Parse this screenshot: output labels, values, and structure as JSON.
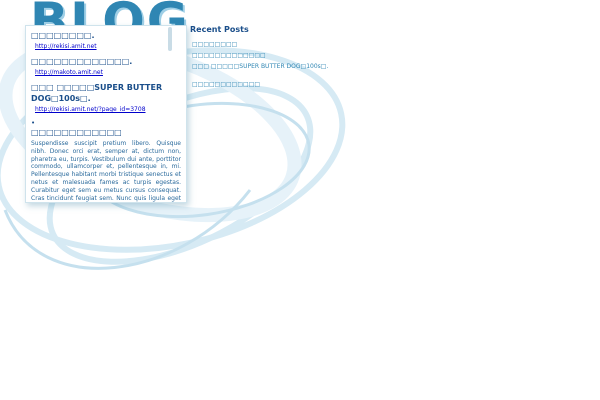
{
  "logo": {
    "text": "BLOG"
  },
  "posts": [
    {
      "title": "□□□□□□□□.",
      "link": "http://rekisi.amit.net"
    },
    {
      "title": "□□□□□□□□□□□□□.",
      "link": "http://makoto.amit.net"
    },
    {
      "title": "□□□ □□□□□SUPER BUTTER DOG□100s□.",
      "link": "http://rekisi.amit.net/?page_id=3708"
    }
  ],
  "bullet": "•",
  "article": {
    "title": "□□□□□□□□□□□□",
    "body": "Suspendisse suscipit pretium libero. Quisque nibh. Donec orci erat, semper at, dictum non, pharetra eu, turpis. Vestibulum dui ante, porttitor commodo, ullamcorper et, pellentesque in, mi. Pellentesque habitant morbi tristique senectus et netus et malesuada fames ac turpis egestas. Curabitur eget sem eu metus cursus consequat. Cras tincidunt feugiat sem. Nunc quis ligula eget libero tempus elementum. Ut lacinia. Praesent sit amet nisl nec eros porta ultrices. Sed id felis. Duis tellus. Ut vehicula mi eu diam. In"
  },
  "sidebar": {
    "heading": "Recent Posts",
    "items": [
      "□□□□□□□□",
      "□□□□□□□□□□□□□",
      "□□□ □□□□□SUPER BUTTER DOG□100s□.",
      "□□□□□□□□□□□□"
    ]
  },
  "colors": {
    "accent": "#2f86b3",
    "title": "#1a4e8a",
    "link": "#0000cc",
    "swirl": "#cfe6f2"
  }
}
